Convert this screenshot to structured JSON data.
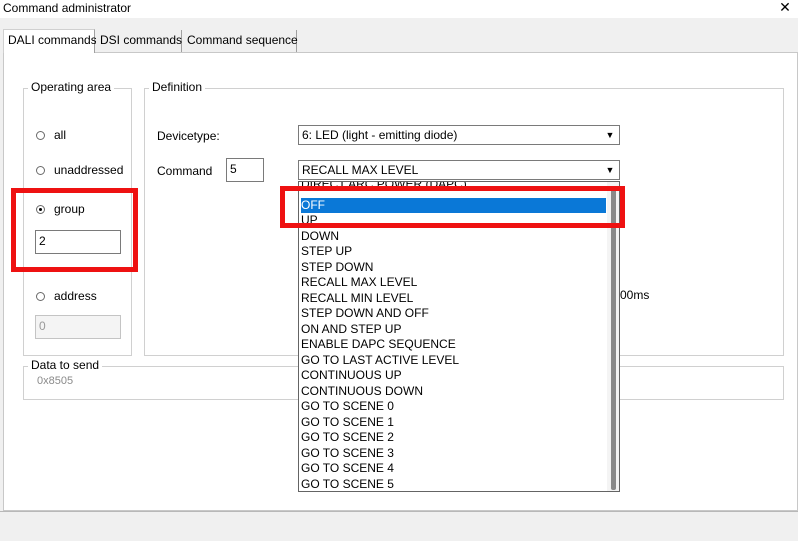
{
  "window": {
    "title": "Command administrator",
    "close_icon": "close-icon"
  },
  "tabs": [
    {
      "label": "DALI commands",
      "active": true
    },
    {
      "label": "DSI commands",
      "active": false
    },
    {
      "label": "Command sequence",
      "active": false
    }
  ],
  "operating_area": {
    "legend": "Operating area",
    "options": [
      {
        "label": "all",
        "checked": false
      },
      {
        "label": "unaddressed",
        "checked": false
      },
      {
        "label": "group",
        "checked": true
      },
      {
        "label": "address",
        "checked": false
      }
    ],
    "group_value": "2",
    "address_value": "0"
  },
  "definition": {
    "legend": "Definition",
    "devicetype_label": "Devicetype:",
    "devicetype_value": "6: LED (light - emitting diode)",
    "command_label": "Command",
    "command_number": "5",
    "command_value": "RECALL MAX LEVEL",
    "partial_text": "00ms"
  },
  "data_to_send": {
    "legend": "Data to send",
    "value": "0x8505"
  },
  "dropdown": {
    "items": [
      "DIRECT ARC POWER (DAPC)",
      "OFF",
      "UP",
      "DOWN",
      "STEP UP",
      "STEP DOWN",
      "RECALL MAX LEVEL",
      "RECALL MIN LEVEL",
      "STEP DOWN AND OFF",
      "ON AND STEP UP",
      "ENABLE DAPC SEQUENCE",
      "GO TO LAST ACTIVE LEVEL",
      "CONTINUOUS UP",
      "CONTINUOUS DOWN",
      "GO TO SCENE 0",
      "GO TO SCENE 1",
      "GO TO SCENE 2",
      "GO TO SCENE 3",
      "GO TO SCENE 4",
      "GO TO SCENE 5"
    ],
    "selected_index": 1
  },
  "colors": {
    "highlight": "#ee1111",
    "selection": "#0a78d7"
  }
}
